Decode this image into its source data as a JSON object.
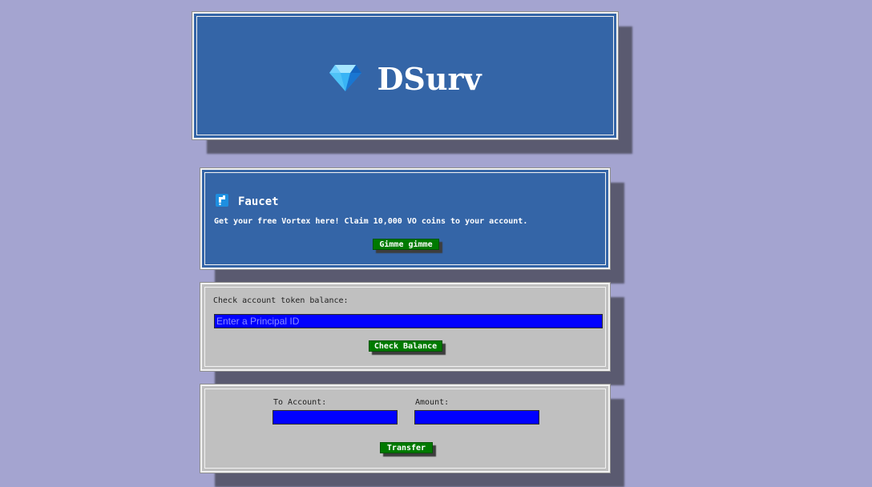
{
  "header": {
    "title": "DSurv",
    "logo_icon": "diamond-icon"
  },
  "faucet": {
    "icon": "faucet-icon",
    "title": "Faucet",
    "description": "Get your free Vortex here! Claim 10,000 VO coins to your account.",
    "button_label": "Gimme gimme"
  },
  "balance": {
    "label": "Check account token balance:",
    "input_placeholder": "Enter a Principal ID",
    "button_label": "Check Balance"
  },
  "transfer": {
    "to_label": "To Account:",
    "amount_label": "Amount:",
    "button_label": "Transfer"
  },
  "colors": {
    "page_background": "#a4a4d0",
    "card_blue": "#3465a7",
    "card_gray": "#c0c0c0",
    "button_green": "#007a00",
    "input_blue": "#0000ff"
  }
}
